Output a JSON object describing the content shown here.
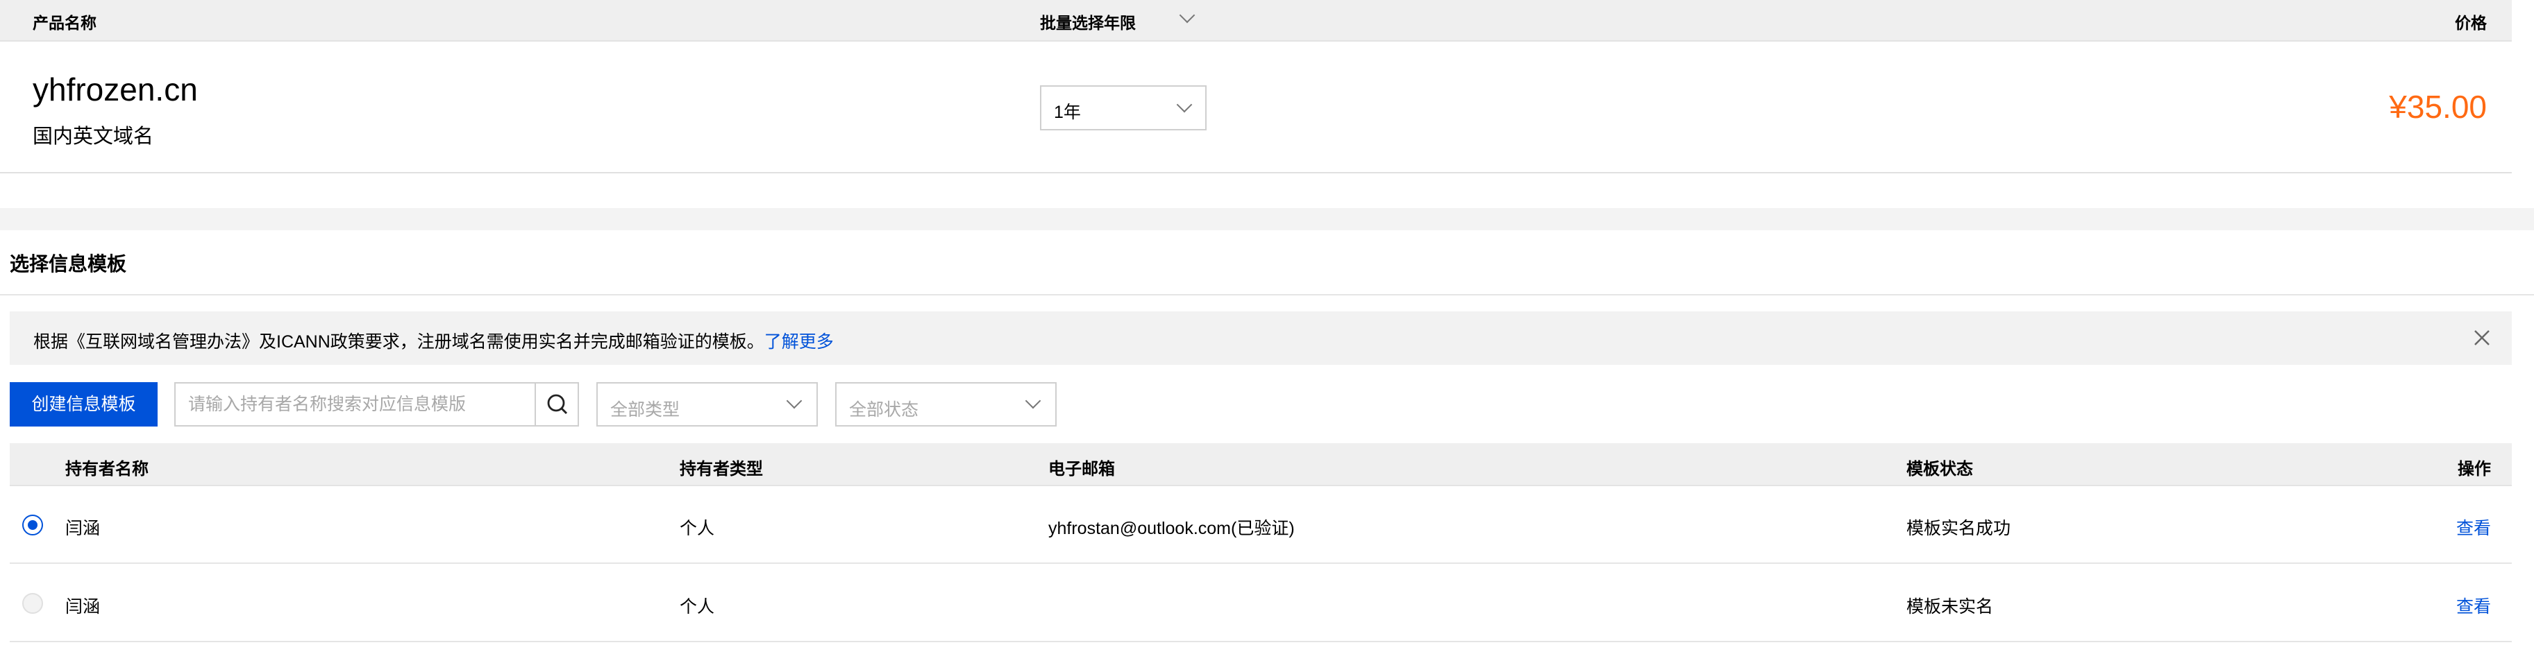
{
  "product_table": {
    "headers": {
      "name": "产品名称",
      "period": "批量选择年限",
      "price": "价格"
    },
    "rows": [
      {
        "domain": "yhfrozen.cn",
        "domain_type": "国内英文域名",
        "period": "1年",
        "price": "¥35.00"
      }
    ]
  },
  "template_section": {
    "title": "选择信息模板",
    "notice": {
      "text": "根据《互联网域名管理办法》及ICANN政策要求，注册域名需使用实名并完成邮箱验证的模板。",
      "link": "了解更多"
    },
    "toolbar": {
      "create_label": "创建信息模板",
      "search_placeholder": "请输入持有者名称搜索对应信息模版",
      "type_filter": "全部类型",
      "status_filter": "全部状态"
    },
    "table": {
      "headers": {
        "name": "持有者名称",
        "type": "持有者类型",
        "email": "电子邮箱",
        "status": "模板状态",
        "op": "操作"
      },
      "rows": [
        {
          "selected": true,
          "name": "闫涵",
          "type": "个人",
          "email": "yhfrostan@outlook.com(已验证)",
          "status": "模板实名成功",
          "op": "查看"
        },
        {
          "selected": false,
          "name": "闫涵",
          "type": "个人",
          "email": "",
          "status": "模板未实名",
          "op": "查看"
        }
      ]
    }
  },
  "colors": {
    "accent": "#0052d9",
    "price": "#ff6a13"
  }
}
